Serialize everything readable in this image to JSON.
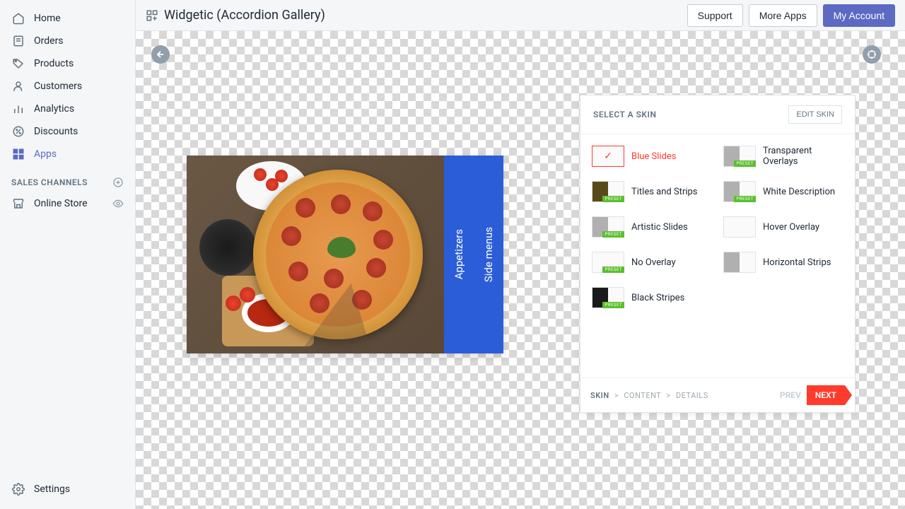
{
  "header": {
    "title": "Widgetic (Accordion Gallery)",
    "actions": {
      "support": "Support",
      "more_apps": "More Apps",
      "my_account": "My Account"
    }
  },
  "sidebar": {
    "items": [
      {
        "label": "Home",
        "icon": "home-icon"
      },
      {
        "label": "Orders",
        "icon": "orders-icon"
      },
      {
        "label": "Products",
        "icon": "tag-icon"
      },
      {
        "label": "Customers",
        "icon": "customer-icon"
      },
      {
        "label": "Analytics",
        "icon": "analytics-icon"
      },
      {
        "label": "Discounts",
        "icon": "discount-icon"
      },
      {
        "label": "Apps",
        "icon": "apps-icon",
        "active": true
      }
    ],
    "section": {
      "title": "SALES CHANNELS"
    },
    "channels": [
      {
        "label": "Online Store",
        "icon": "store-icon"
      }
    ],
    "bottom": {
      "label": "Settings",
      "icon": "settings-icon"
    }
  },
  "accordion": {
    "slides": [
      {
        "label": "Appetizers"
      },
      {
        "label": "Side menus"
      }
    ]
  },
  "panel": {
    "title": "SELECT A SKIN",
    "edit": "EDIT SKIN",
    "skins": [
      {
        "label": "Blue Slides",
        "selected": true,
        "preset": false,
        "thumb": "white"
      },
      {
        "label": "Transparent Overlays",
        "preset": true,
        "thumb": "split-grey"
      },
      {
        "label": "Titles and Strips",
        "preset": true,
        "thumb": "split-olive"
      },
      {
        "label": "White Description",
        "preset": true,
        "thumb": "split-grey"
      },
      {
        "label": "Artistic Slides",
        "preset": true,
        "thumb": "split-grey"
      },
      {
        "label": "Hover Overlay",
        "preset": false,
        "thumb": "white"
      },
      {
        "label": "No Overlay",
        "preset": true,
        "thumb": "white"
      },
      {
        "label": "Horizontal Strips",
        "preset": false,
        "thumb": "split-grey"
      },
      {
        "label": "Black Stripes",
        "preset": true,
        "thumb": "split-black"
      }
    ],
    "crumbs": {
      "skin": "SKIN",
      "content": "CONTENT",
      "details": "DETAILS"
    },
    "footer": {
      "prev": "PREV",
      "next": "NEXT"
    }
  },
  "colors": {
    "accent": "#5c6ac4",
    "danger": "#ff3b2e",
    "preset": "#5abf2e"
  }
}
